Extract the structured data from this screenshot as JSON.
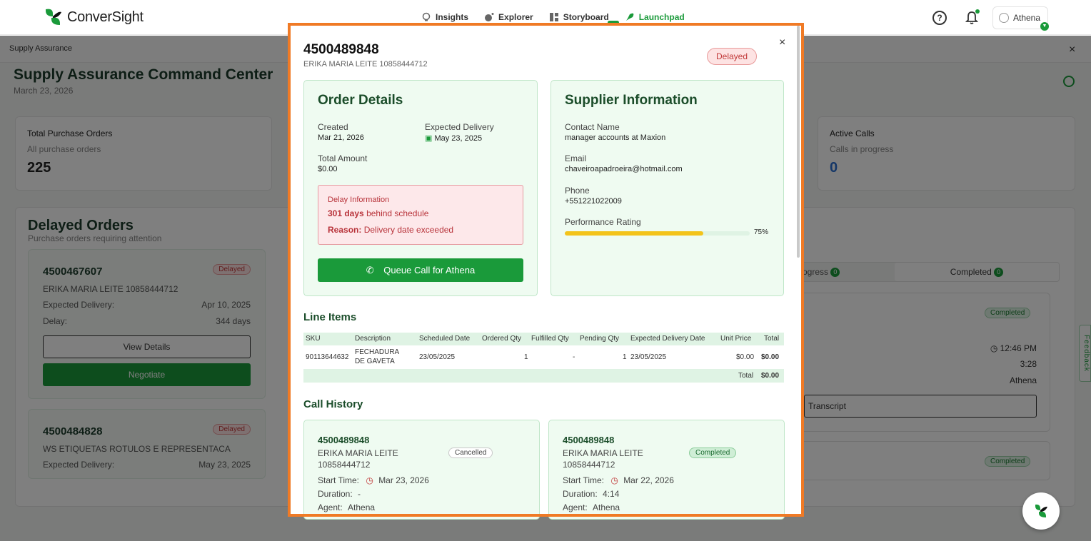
{
  "app": {
    "logo_text": "ConverSight",
    "nav": [
      {
        "label": "Insights",
        "icon": "bulb-icon"
      },
      {
        "label": "Explorer",
        "icon": "explorer-icon"
      },
      {
        "label": "Storyboard",
        "icon": "storyboard-icon"
      },
      {
        "label": "Launchpad",
        "icon": "rocket-icon",
        "active": true
      }
    ],
    "user": "Athena",
    "accent": "#1a9a3a"
  },
  "background": {
    "breadcrumb": "Supply Assurance",
    "title": "Supply Assurance Command Center",
    "date": "March 23, 2026",
    "stats": [
      {
        "title": "Total Purchase Orders",
        "sub": "All purchase orders",
        "value": "225"
      },
      {
        "title": "Active Calls",
        "sub": "Calls in progress",
        "value": "0"
      }
    ],
    "delayed_title": "Delayed Orders",
    "delayed_sub": "Purchase orders requiring attention",
    "order_cards": [
      {
        "id": "4500467607",
        "badge": "Delayed",
        "name": "ERIKA MARIA LEITE 10858444712",
        "exp_label": "Expected Delivery:",
        "exp_value": "Apr 10, 2025",
        "delay_label": "Delay:",
        "delay_value": "344 days",
        "view_btn": "View Details",
        "negotiate_btn": "Negotiate"
      },
      {
        "id": "4500484828",
        "badge": "Delayed",
        "name": "WS ETIQUETAS ROTULOS E REPRESENTACA",
        "exp_label": "Expected Delivery:",
        "exp_value": "May 23, 2025"
      }
    ],
    "tabs": {
      "in_progress": "ogress",
      "in_progress_count": "0",
      "completed": "Completed",
      "completed_count": "0"
    },
    "right_cards": [
      {
        "badge": "Completed",
        "time": "12:46 PM",
        "duration": "3:28",
        "agent": "Athena",
        "transcript_btn": "Transcript"
      },
      {
        "badge": "Completed"
      }
    ],
    "feedback": "Feedback"
  },
  "modal": {
    "po_number": "4500489848",
    "supplier_name": "ERIKA MARIA LEITE 10858444712",
    "status": "Delayed",
    "order_details": {
      "title": "Order Details",
      "created_label": "Created",
      "created_value": "Mar 21, 2026",
      "expected_label": "Expected Delivery",
      "expected_value": "May 23, 2025",
      "total_label": "Total Amount",
      "total_value": "$0.00",
      "delay_title": "Delay Information",
      "delay_days": "301 days",
      "delay_days_suffix": "behind schedule",
      "reason_label": "Reason:",
      "reason_value": "Delivery date exceeded",
      "queue_button": "Queue Call for Athena"
    },
    "supplier_info": {
      "title": "Supplier Information",
      "contact_label": "Contact Name",
      "contact_value": "manager accounts at Maxion",
      "email_label": "Email",
      "email_value": "chaveiroapadroeira@hotmail.com",
      "phone_label": "Phone",
      "phone_value": "+551221022009",
      "rating_label": "Performance Rating",
      "rating_value": "75%",
      "rating_fraction": 0.75
    },
    "line_items": {
      "title": "Line Items",
      "headers": [
        "SKU",
        "Description",
        "Scheduled Date",
        "Ordered Qty",
        "Fulfilled Qty",
        "Pending Qty",
        "Expected Delivery Date",
        "Unit Price",
        "Total"
      ],
      "rows": [
        {
          "sku": "90113644632",
          "description_line1": "FECHADURA",
          "description_line2": "DE GAVETA",
          "scheduled": "23/05/2025",
          "ordered": "1",
          "fulfilled": "-",
          "pending": "1",
          "expected": "23/05/2025",
          "unit_price": "$0.00",
          "total": "$0.00"
        }
      ],
      "total_label": "Total",
      "total_value": "$0.00"
    },
    "call_history": {
      "title": "Call History",
      "calls": [
        {
          "id": "4500489848",
          "name_line1": "ERIKA MARIA LEITE",
          "name_line2": "10858444712",
          "status": "Cancelled",
          "start_label": "Start Time:",
          "start_value": "Mar 23, 2026",
          "duration_label": "Duration:",
          "duration_value": "-",
          "agent_label": "Agent:",
          "agent_value": "Athena"
        },
        {
          "id": "4500489848",
          "name_line1": "ERIKA MARIA LEITE",
          "name_line2": "10858444712",
          "status": "Completed",
          "start_label": "Start Time:",
          "start_value": "Mar 22, 2026",
          "duration_label": "Duration:",
          "duration_value": "4:14",
          "agent_label": "Agent:",
          "agent_value": "Athena"
        }
      ]
    },
    "close_glyph": "×"
  }
}
